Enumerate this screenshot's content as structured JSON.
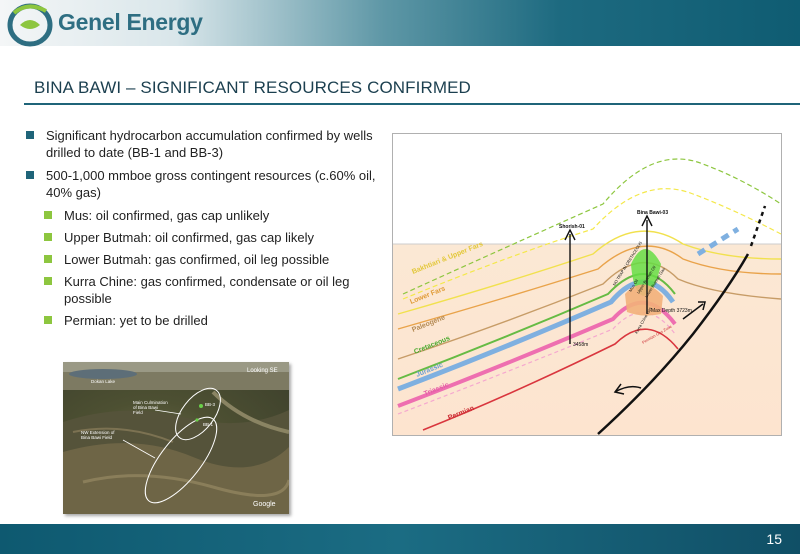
{
  "header": {
    "brand_name": "Genel Energy",
    "slide_title": "BINA BAWI – SIGNIFICANT RESOURCES CONFIRMED"
  },
  "bullets": [
    {
      "level": 1,
      "text": "Significant hydrocarbon accumulation confirmed by wells drilled to date (BB-1 and BB-3)"
    },
    {
      "level": 1,
      "text": "500-1,000 mmboe gross contingent resources (c.60% oil, 40% gas)"
    },
    {
      "level": 2,
      "text": "Mus: oil confirmed, gas cap unlikely"
    },
    {
      "level": 2,
      "text": "Upper Butmah: oil confirmed, gas cap likely"
    },
    {
      "level": 2,
      "text": "Lower Butmah: gas confirmed, oil leg possible"
    },
    {
      "level": 2,
      "text": "Kurra Chine: gas confirmed, condensate or oil leg possible"
    },
    {
      "level": 2,
      "text": "Permian: yet to be drilled"
    }
  ],
  "map": {
    "view_label": "Looking SE",
    "lake_label": "Dokan Lake",
    "main_culmination_label": "Main Culmination of Bina Bawi Field",
    "nw_extension_label": "NW Extension of Bina Bawi Field",
    "bb1_label": "BB-1",
    "bb3_label": "BB-3",
    "watermark": "Google"
  },
  "cross_section": {
    "well_left": "Shorish-01",
    "well_right": "Bina Bawi-03",
    "td_left": "3458m",
    "td_right": "Max Depth 3723m",
    "no_trap_label": "NO TRAP IN CRETACEOUS",
    "label_ov": "Upper Butmah Oil",
    "label_oil": "Mus Oil",
    "label_gas": "Lower Butmah Gas",
    "label_kurra": "Kurra Chine Gas",
    "label_perm": "Permian Gas Zone",
    "formations": {
      "bakhtiari": "Bakhtiari & Upper Fars",
      "lower_fars": "Lower Fars",
      "paleogene": "Paleogene",
      "cretaceous": "Cretaceous",
      "jurassic": "Jurassic",
      "triassic": "Triassic",
      "permian": "Permian"
    }
  },
  "footer": {
    "page_number": "15"
  },
  "colors": {
    "brand_teal": "#1f6479",
    "bullet_green": "#8dc63f",
    "footer_teal": "#0e5970"
  }
}
